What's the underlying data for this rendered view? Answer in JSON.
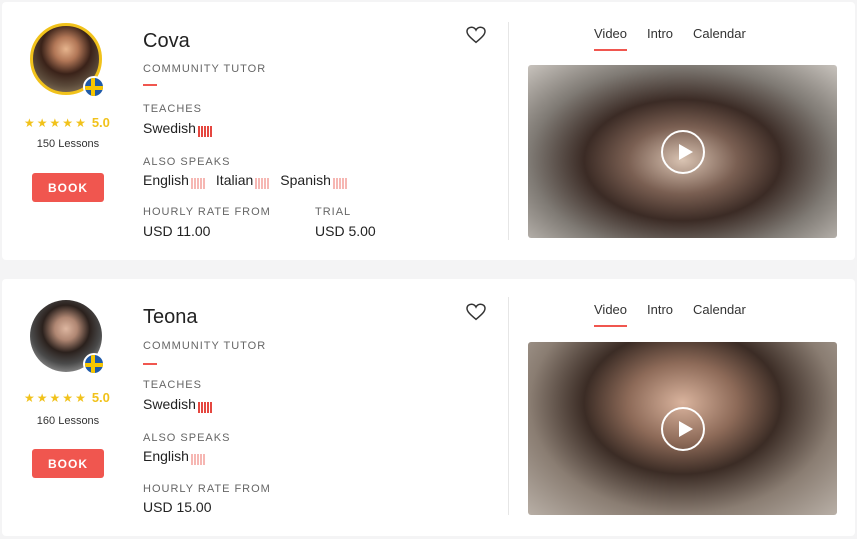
{
  "tutors": [
    {
      "name": "Cova",
      "role": "COMMUNITY TUTOR",
      "rating": "5.0",
      "lessons": "150 Lessons",
      "book_label": "BOOK",
      "teaches_label": "TEACHES",
      "teaches": "Swedish",
      "also_speaks_label": "ALSO SPEAKS",
      "also_speaks": [
        "English",
        "Italian",
        "Spanish"
      ],
      "rate_label": "HOURLY RATE FROM",
      "rate": "USD 11.00",
      "trial_label": "TRIAL",
      "trial": "USD 5.00",
      "tabs": [
        "Video",
        "Intro",
        "Calendar"
      ],
      "active_tab": "Video",
      "flag": "sweden"
    },
    {
      "name": "Teona",
      "role": "COMMUNITY TUTOR",
      "rating": "5.0",
      "lessons": "160 Lessons",
      "book_label": "BOOK",
      "teaches_label": "TEACHES",
      "teaches": "Swedish",
      "also_speaks_label": "ALSO SPEAKS",
      "also_speaks": [
        "English"
      ],
      "rate_label": "HOURLY RATE FROM",
      "rate": "USD 15.00",
      "tabs": [
        "Video",
        "Intro",
        "Calendar"
      ],
      "active_tab": "Video",
      "flag": "sweden"
    }
  ],
  "icons": {
    "favorite": "heart-icon",
    "play": "play-icon",
    "rating": "star-icon"
  },
  "colors": {
    "accent": "#f0564f",
    "star": "#f1c21b",
    "native_level": "#e54740",
    "other_level": "#f6b7b3"
  }
}
